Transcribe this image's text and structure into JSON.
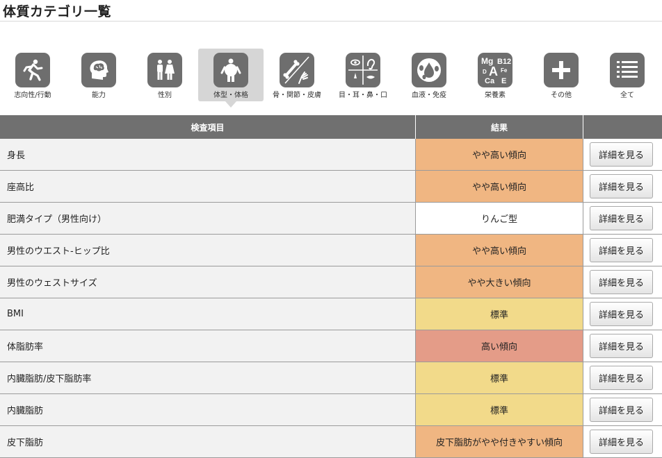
{
  "page": {
    "title": "体質カテゴリ一覧"
  },
  "categories": [
    {
      "label": "志向性/行動",
      "icon": "running-person-icon",
      "active": false
    },
    {
      "label": "能力",
      "icon": "brain-head-icon",
      "active": false
    },
    {
      "label": "性別",
      "icon": "male-female-icon",
      "active": false
    },
    {
      "label": "体型・体格",
      "icon": "body-shape-icon",
      "active": true
    },
    {
      "label": "骨・関節・皮膚",
      "icon": "bone-skin-icon",
      "active": false
    },
    {
      "label": "目・耳・鼻・口",
      "icon": "eye-ear-nose-mouth-icon",
      "active": false
    },
    {
      "label": "血液・免疫",
      "icon": "blood-drop-icon",
      "active": false
    },
    {
      "label": "栄養素",
      "icon": "nutrients-icon",
      "active": false
    },
    {
      "label": "その他",
      "icon": "plus-icon",
      "active": false
    },
    {
      "label": "全て",
      "icon": "list-icon",
      "active": false
    }
  ],
  "nutrient_icon_text": {
    "mg": "Mg",
    "b12": "B12",
    "fe": "Fe",
    "d": "D",
    "a": "A",
    "ca": "Ca",
    "e": "E"
  },
  "table": {
    "headers": {
      "item": "検査項目",
      "result": "結果"
    },
    "detail_label": "詳細を見る",
    "rows": [
      {
        "item": "身長",
        "result": "やや高い傾向",
        "level": "orange"
      },
      {
        "item": "座高比",
        "result": "やや高い傾向",
        "level": "orange"
      },
      {
        "item": "肥満タイプ（男性向け）",
        "result": "りんご型",
        "level": "white"
      },
      {
        "item": "男性のウエスト-ヒップ比",
        "result": "やや高い傾向",
        "level": "orange"
      },
      {
        "item": "男性のウェストサイズ",
        "result": "やや大きい傾向",
        "level": "orange"
      },
      {
        "item": "BMI",
        "result": "標準",
        "level": "yellow"
      },
      {
        "item": "体脂肪率",
        "result": "高い傾向",
        "level": "red"
      },
      {
        "item": "内臓脂肪/皮下脂肪率",
        "result": "標準",
        "level": "yellow"
      },
      {
        "item": "内臓脂肪",
        "result": "標準",
        "level": "yellow"
      },
      {
        "item": "皮下脂肪",
        "result": "皮下脂肪がやや付きやすい傾向",
        "level": "orange"
      }
    ]
  },
  "colors": {
    "orange": "#f0b682",
    "white": "#ffffff",
    "yellow": "#f2da8a",
    "red": "#e49c88",
    "header": "#707070",
    "icon_bg": "#6e6e6e"
  }
}
